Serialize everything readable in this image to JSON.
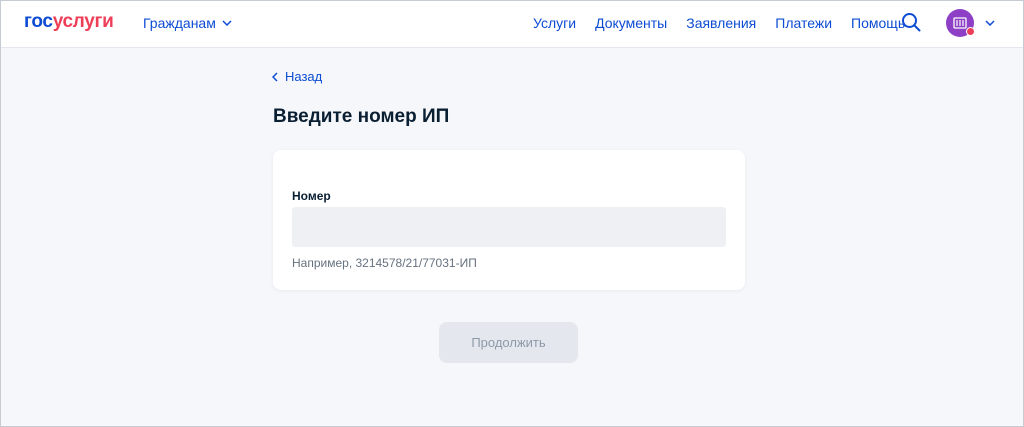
{
  "header": {
    "logo_part1": "гос",
    "logo_part2": "услуги",
    "audience_label": "Гражданам",
    "nav": [
      "Услуги",
      "Документы",
      "Заявления",
      "Платежи",
      "Помощь"
    ]
  },
  "page": {
    "back_label": "Назад",
    "title": "Введите номер ИП"
  },
  "form": {
    "field_label": "Номер",
    "field_value": "",
    "hint": "Например, 3214578/21/77031-ИП"
  },
  "actions": {
    "continue_label": "Продолжить"
  },
  "colors": {
    "brand_blue": "#0d4cd3",
    "brand_red": "#ee3f58",
    "avatar": "#8d3fc6",
    "background": "#f5f7fa"
  }
}
